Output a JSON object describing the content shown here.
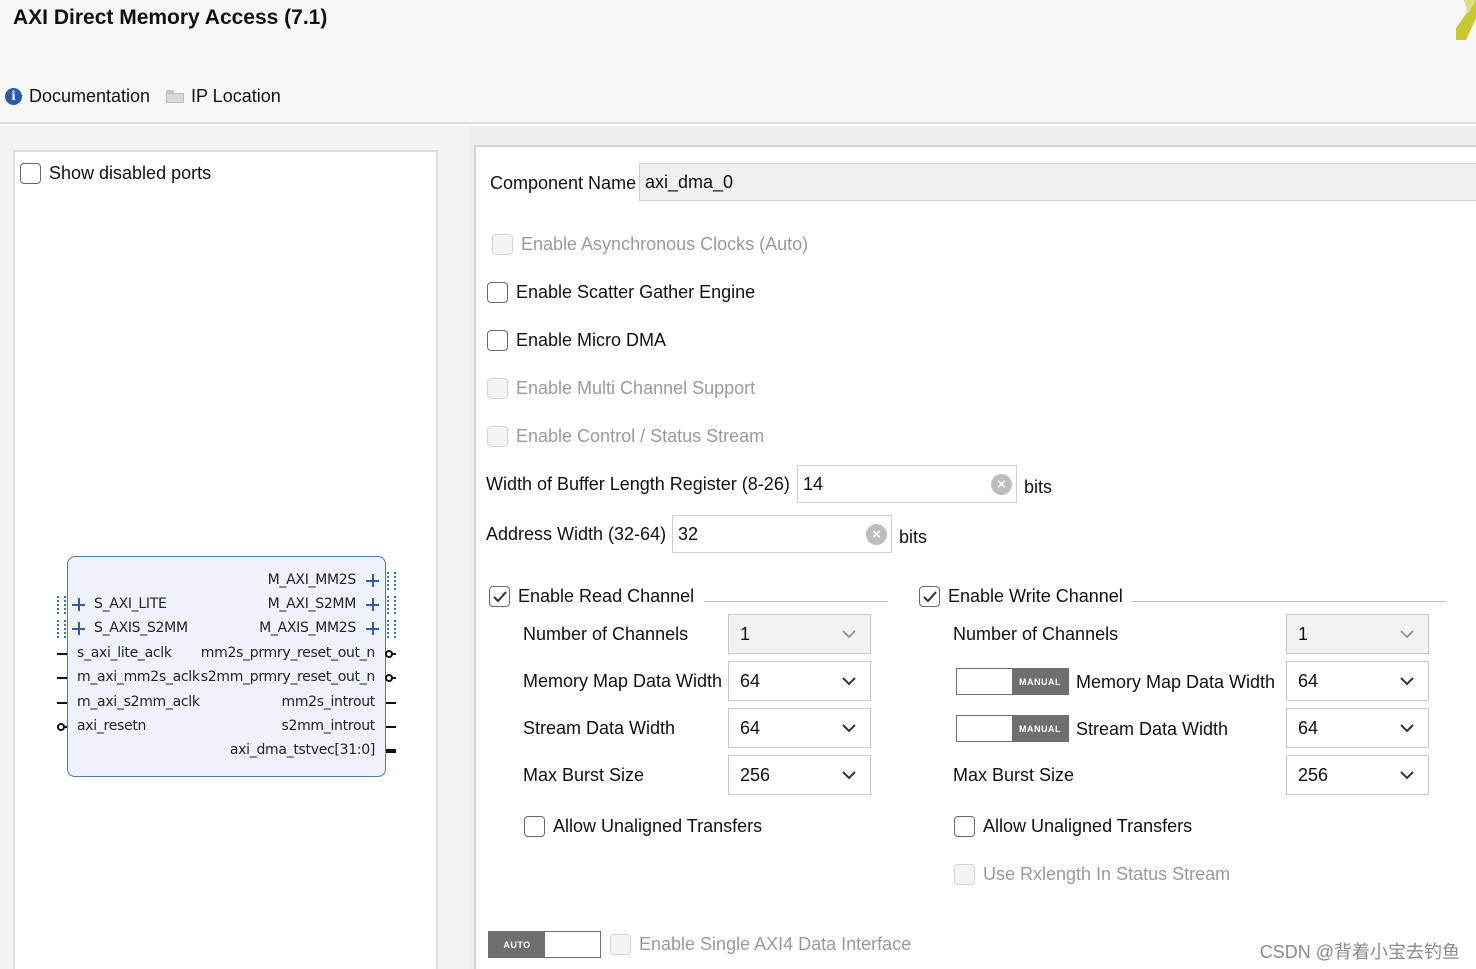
{
  "header": {
    "title": "AXI Direct Memory Access (7.1)",
    "documentation": "Documentation",
    "ip_location": "IP Location"
  },
  "left": {
    "show_disabled_ports": "Show disabled ports",
    "block": {
      "left_ports": [
        "S_AXI_LITE",
        "S_AXIS_S2MM",
        "s_axi_lite_aclk",
        "m_axi_mm2s_aclk",
        "m_axi_s2mm_aclk",
        "axi_resetn"
      ],
      "right_ports": [
        "M_AXI_MM2S",
        "M_AXI_S2MM",
        "M_AXIS_MM2S",
        "mm2s_prmry_reset_out_n",
        "s2mm_prmry_reset_out_n",
        "mm2s_introut",
        "s2mm_introut",
        "axi_dma_tstvec[31:0]"
      ]
    }
  },
  "right": {
    "component_name_label": "Component Name",
    "component_name_value": "axi_dma_0",
    "opt_async_clocks": "Enable Asynchronous Clocks (Auto)",
    "opt_scatter_gather": "Enable Scatter Gather Engine",
    "opt_micro_dma": "Enable Micro DMA",
    "opt_multi_channel": "Enable Multi Channel Support",
    "opt_control_status": "Enable Control / Status Stream",
    "buffer_len_label": "Width of Buffer Length Register (8-26)",
    "buffer_len_value": "14",
    "addr_width_label": "Address Width (32-64)",
    "addr_width_value": "32",
    "bits": "bits",
    "read": {
      "title": "Enable Read Channel",
      "num_channels_label": "Number of Channels",
      "num_channels_value": "1",
      "mm_width_label": "Memory Map Data Width",
      "mm_width_value": "64",
      "stream_width_label": "Stream Data Width",
      "stream_width_value": "64",
      "burst_label": "Max Burst Size",
      "burst_value": "256",
      "unaligned": "Allow Unaligned Transfers"
    },
    "write": {
      "title": "Enable Write Channel",
      "num_channels_label": "Number of Channels",
      "num_channels_value": "1",
      "mm_width_label": "Memory Map Data Width",
      "mm_width_value": "64",
      "stream_width_label": "Stream Data Width",
      "stream_width_value": "64",
      "burst_label": "Max Burst Size",
      "burst_value": "256",
      "unaligned": "Allow Unaligned Transfers",
      "rxlength": "Use Rxlength In Status Stream"
    },
    "manual_badge": "MANUAL",
    "auto_badge": "AUTO",
    "single_axi4": "Enable Single AXI4 Data Interface"
  },
  "watermark": "CSDN @背着小宝去钓鱼",
  "colors": {
    "accent": "#2a5aa8",
    "block_fill": "#eef3fb",
    "disabled_text": "#9a9a9a"
  }
}
